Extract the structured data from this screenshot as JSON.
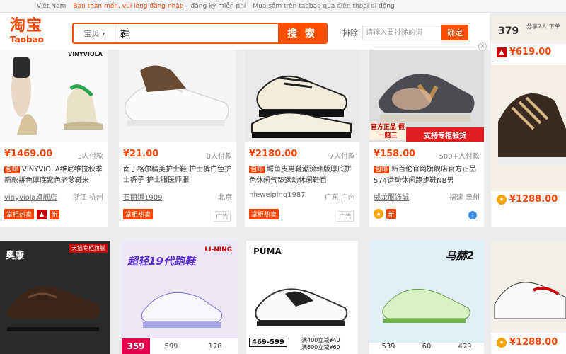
{
  "topbar": {
    "country": "Việt Nam",
    "login_prompt": "Bạn thân mến, vui lòng đăng nhập",
    "register": "đăng ký miễn phí",
    "app_promo": "Mua sắm trên taobao qua điện thoại di động"
  },
  "logo": {
    "cn": "淘宝",
    "en": "Taobao"
  },
  "search": {
    "category": "宝贝",
    "query": "鞋",
    "button": "搜 索"
  },
  "exclude": {
    "label": "排除",
    "placeholder": "请输入要排除的词",
    "button": "确定"
  },
  "colors": {
    "accent": "#ff5000",
    "price": "#ff4400"
  },
  "products": [
    {
      "price": "¥1469.00",
      "paid": "3人付款",
      "badge": "包邮",
      "title": "VINYVIOLA维尼维拉秋季新款拼色厚底紫色老爹鞋米",
      "shop": "vinyviola旗舰店",
      "loc": "浙江 杭州",
      "tag": "掌柜热卖",
      "new": "新",
      "logo": "VINYVIOLA"
    },
    {
      "price": "¥21.00",
      "paid": "0人付款",
      "title": "南丁格尔精美护士鞋 护士裤白色护士裤子 护士服医师服",
      "shop": "石丽娜1909",
      "loc": "北京",
      "tag": "掌柜热卖",
      "ad": "广告"
    },
    {
      "price": "¥2180.00",
      "paid": "7人付款",
      "badge": "包邮",
      "title": "鳄鱼皮男鞋潮流韩版厚底拼色休闲气垫运动休闲鞋百",
      "shop": "nieweiping1987",
      "loc": "广东 广州",
      "tag": "掌柜热卖",
      "ad": "广告"
    },
    {
      "price": "¥158.00",
      "paid": "500+人付款",
      "badge": "包邮",
      "title": "新百伦官网旗舰店官方正品574运动休闲跑步鞋NB男",
      "shop": "威龙服饰城",
      "loc": "福建 泉州",
      "promo_left": "官方正品 假一赔三",
      "promo_right": "支持专柜验货",
      "new": "新"
    },
    {
      "top_price": "379",
      "top_promo": "分享2人 下单",
      "price": "¥619.00",
      "price2": "¥1288.00"
    },
    {
      "brand": "奥康",
      "store": "天猫专柜旗舰"
    },
    {
      "headline": "超轻19代跑鞋",
      "brand": "LI-NING",
      "prices": [
        "359",
        "599",
        "178"
      ]
    },
    {
      "brand": "PUMA",
      "price_badge": "469-599",
      "coupon1": "满400立减¥40",
      "coupon2": "满600立减¥60"
    },
    {
      "brand": "马赫2",
      "prices": [
        "539",
        "60",
        "479"
      ]
    },
    {
      "price": "¥1288.00"
    }
  ]
}
